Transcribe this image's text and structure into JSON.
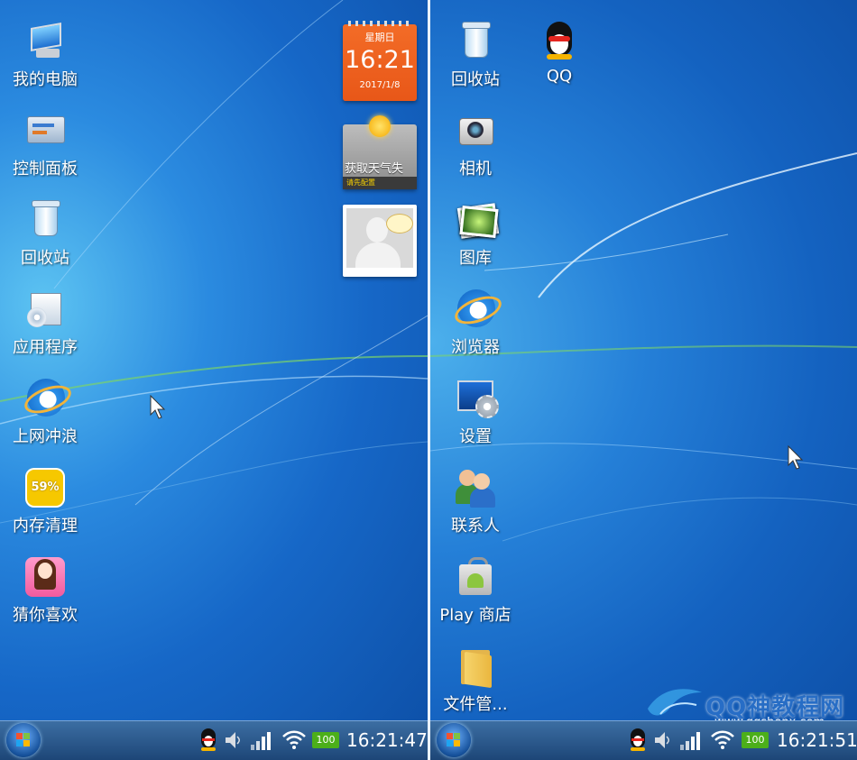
{
  "left_screen": {
    "icons": [
      {
        "label": "我的电脑"
      },
      {
        "label": "控制面板"
      },
      {
        "label": "回收站"
      },
      {
        "label": "应用程序"
      },
      {
        "label": "上网冲浪"
      },
      {
        "label": "内存清理",
        "badge": "59%"
      },
      {
        "label": "猜你喜欢"
      }
    ],
    "clock_widget": {
      "day": "星期日",
      "time": "16:21",
      "date": "2017/1/8"
    },
    "weather_widget": {
      "message": "获取天气失",
      "hint": "请先配置"
    },
    "taskbar": {
      "battery": "100",
      "time": "16:21:47"
    }
  },
  "right_screen": {
    "icons": [
      {
        "label": "回收站"
      },
      {
        "label": "QQ"
      },
      {
        "label": "相机"
      },
      {
        "label": "图库"
      },
      {
        "label": "浏览器"
      },
      {
        "label": "设置"
      },
      {
        "label": "联系人"
      },
      {
        "label": "Play 商店"
      },
      {
        "label": "文件管..."
      }
    ],
    "taskbar": {
      "battery": "100",
      "time": "16:21:51"
    }
  },
  "watermark": {
    "title": "QQ神教程网",
    "url": "www.qqshenx.com"
  },
  "colors": {
    "desktop": "#1565b8",
    "taskbar": "#1d4677",
    "battery": "#4caf1a",
    "clock_widget": "#f36c27"
  }
}
